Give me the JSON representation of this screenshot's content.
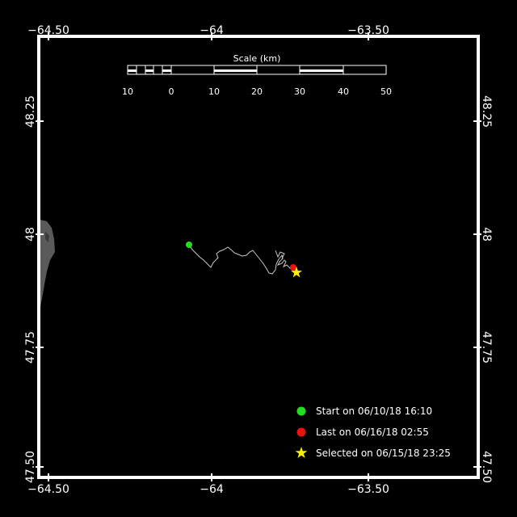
{
  "map": {
    "lon_labels": [
      "−64.50",
      "−64",
      "−63.50"
    ],
    "lat_labels": [
      "48.25",
      "48",
      "47.75",
      "47.50"
    ],
    "scale_title": "Scale (km)",
    "scale_ticks": [
      "10",
      "0",
      "10",
      "20",
      "30",
      "40",
      "50"
    ]
  },
  "legend": {
    "start": "Start on 06/10/18 16:10",
    "last": "Last on 06/16/18 02:55",
    "selected": "Selected on 06/15/18 23:25"
  },
  "colors": {
    "background": "#000000",
    "land": "#5a5a5a",
    "track": "#c8c8c8",
    "start": "#22dd22",
    "last": "#ee1111",
    "selected": "#ffee00"
  }
}
